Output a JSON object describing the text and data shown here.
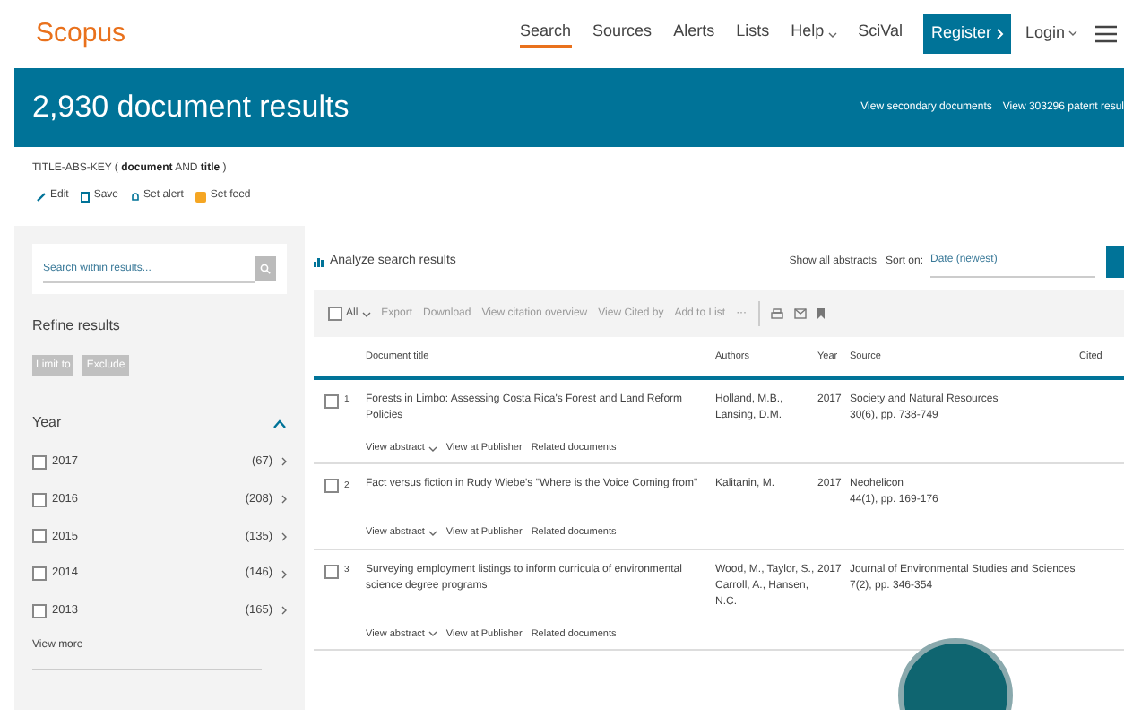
{
  "header": {
    "logo": "Scopus",
    "nav": [
      {
        "label": "Search",
        "selected": true,
        "dropdown": false
      },
      {
        "label": "Sources",
        "selected": false,
        "dropdown": false
      },
      {
        "label": "Alerts",
        "selected": false,
        "dropdown": false
      },
      {
        "label": "Lists",
        "selected": false,
        "dropdown": false
      },
      {
        "label": "Help",
        "selected": false,
        "dropdown": true
      },
      {
        "label": "SciVal",
        "selected": false,
        "dropdown": false
      }
    ],
    "register": "Register",
    "login": "Login"
  },
  "banner": {
    "title": "2,930 document results",
    "links": [
      "View secondary documents",
      "View 303296 patent resul"
    ]
  },
  "query": {
    "prefix": "TITLE-ABS-KEY (",
    "term1": "document",
    "op": "AND",
    "term2": "title",
    "suffix": ")"
  },
  "query_actions": [
    "Edit",
    "Save",
    "Set alert",
    "Set feed"
  ],
  "sidebar": {
    "search_placeholder": "Search within results...",
    "refine_title": "Refine results",
    "buttons": [
      "Limit to",
      "Exclude"
    ],
    "facet": {
      "title": "Year",
      "expanded": true,
      "items": [
        {
          "label": "2017",
          "count": "(67)",
          "checked": false
        },
        {
          "label": "2016",
          "count": "(208)",
          "checked": false
        },
        {
          "label": "2015",
          "count": "(135)",
          "checked": false
        },
        {
          "label": "2014",
          "count": "(146)",
          "checked": false
        },
        {
          "label": "2013",
          "count": "(165)",
          "checked": false
        }
      ],
      "more": "View more"
    }
  },
  "results": {
    "analyze": "Analyze search results",
    "show_abstracts": "Show all abstracts",
    "sort_label": "Sort on:",
    "sort_value": "Date (newest)",
    "select_all": "All",
    "select_all_checked": false,
    "toolbar": [
      "Export",
      "Download",
      "View citation overview",
      "View Cited by",
      "Add to List",
      "···"
    ],
    "columns": [
      "Document title",
      "Authors",
      "Year",
      "Source",
      "Cited"
    ],
    "rows": [
      {
        "number": "1",
        "checked": false,
        "title": "Forests in Limbo: Assessing Costa Rica's Forest and Land Reform Policies",
        "authors": "Holland, M.B., Lansing, D.M.",
        "year": "2017",
        "source": "Society and Natural Resources",
        "source_detail": "30(6), pp. 738-749",
        "links": [
          "View abstract",
          "View at Publisher",
          "Related documents"
        ]
      },
      {
        "number": "2",
        "checked": false,
        "title": "Fact versus fiction in Rudy Wiebe's \"Where is the Voice Coming from\"",
        "authors": "Kalitanin, M.",
        "year": "2017",
        "source": "Neohelicon",
        "source_detail": "44(1), pp. 169-176",
        "links": [
          "View abstract",
          "View at Publisher",
          "Related documents"
        ]
      },
      {
        "number": "3",
        "checked": false,
        "title": "Surveying employment listings to inform curricula of environmental science degree programs",
        "authors": "Wood, M., Taylor, S., Carroll, A., Hansen, N.C.",
        "year": "2017",
        "source": "Journal of Environmental Studies and Sciences",
        "source_detail": "7(2), pp. 346-354",
        "links": [
          "View abstract",
          "View at Publisher",
          "Related documents"
        ]
      }
    ]
  }
}
